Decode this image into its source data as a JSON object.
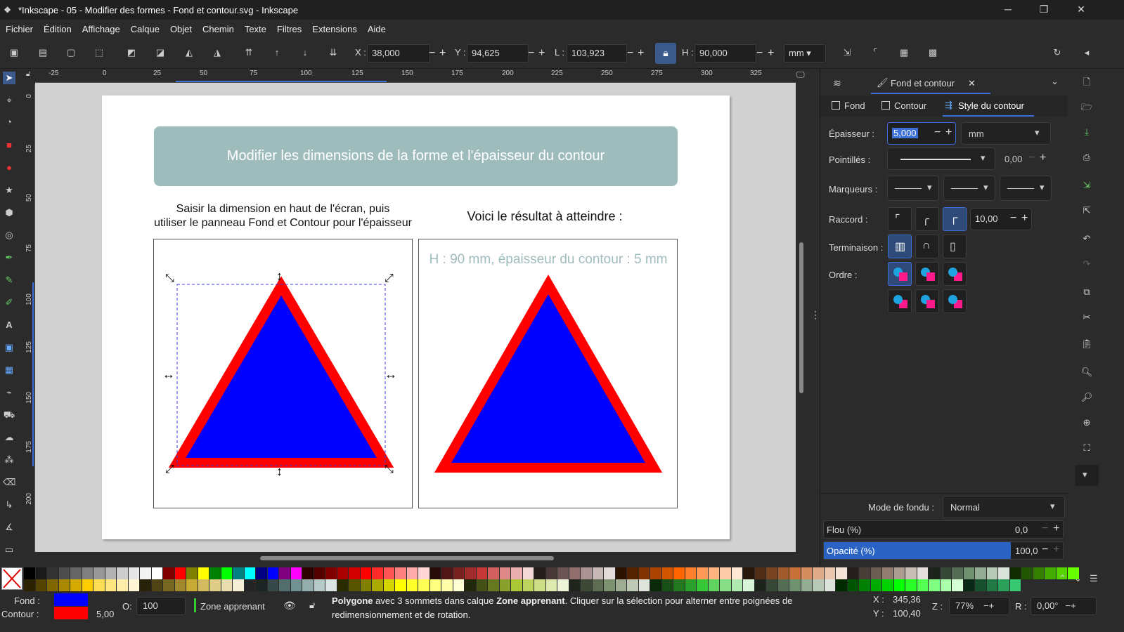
{
  "window": {
    "title": "*Inkscape - 05 - Modifier des formes - Fond et contour.svg - Inkscape",
    "minimize": "─",
    "maximize": "❐",
    "close": "✕"
  },
  "menu": [
    "Fichier",
    "Édition",
    "Affichage",
    "Calque",
    "Objet",
    "Chemin",
    "Texte",
    "Filtres",
    "Extensions",
    "Aide"
  ],
  "toolbar": {
    "x_label": "X :",
    "x_value": "38,000",
    "y_label": "Y :",
    "y_value": "94,625",
    "w_label": "L :",
    "w_value": "103,923",
    "h_label": "H :",
    "h_value": "90,000",
    "unit": "mm",
    "minus": "−",
    "plus": "+"
  },
  "ruler": {
    "h_ticks": [
      "-25",
      "0",
      "25",
      "50",
      "75",
      "100",
      "125",
      "150",
      "175",
      "200",
      "225",
      "250",
      "275",
      "300",
      "325"
    ],
    "v_ticks": [
      "0",
      "25",
      "50",
      "75",
      "100",
      "125",
      "150",
      "175",
      "200"
    ]
  },
  "page": {
    "banner": "Modifier les dimensions de la forme et l'épaisseur du contour",
    "instruction_line1": "Saisir la dimension en haut de l'écran, puis",
    "instruction_line2": "utiliser le panneau Fond et Contour pour l'épaisseur",
    "result_title": "Voici le résultat à atteindre :",
    "hint": "H : 90 mm, épaisseur du contour : 5 mm",
    "fill_color": "#0000ff",
    "stroke_color": "#ff0000"
  },
  "panel": {
    "tab_title": "Fond et contour",
    "tab_close": "✕",
    "subtabs": [
      "Fond",
      "Contour",
      "Style du contour"
    ],
    "epaisseur_label": "Épaisseur :",
    "epaisseur_value": "5,000",
    "epaisseur_unit": "mm",
    "pointilles_label": "Pointillés :",
    "pointilles_offset": "0,00",
    "marqueurs_label": "Marqueurs :",
    "raccord_label": "Raccord :",
    "raccord_value": "10,00",
    "terminaison_label": "Terminaison :",
    "ordre_label": "Ordre :",
    "mode_label": "Mode de fondu :",
    "mode_value": "Normal",
    "flou_label": "Flou (%)",
    "flou_value": "0,0",
    "opacite_label": "Opacité (%)",
    "opacite_value": "100,0",
    "opacite_level": 1.0
  },
  "palette_colors": [
    "#000000",
    "#1a1a1a",
    "#333333",
    "#4d4d4d",
    "#666666",
    "#808080",
    "#999999",
    "#b3b3b3",
    "#cccccc",
    "#e6e6e6",
    "#f2f2f2",
    "#ffffff",
    "#800000",
    "#ff0000",
    "#808000",
    "#ffff00",
    "#008000",
    "#00ff00",
    "#008080",
    "#00ffff",
    "#000080",
    "#0000ff",
    "#800080",
    "#ff00ff",
    "#2b0000",
    "#550000",
    "#800000",
    "#aa0000",
    "#d40000",
    "#ff0000",
    "#ff2a2a",
    "#ff5555",
    "#ff8080",
    "#ffaaaa",
    "#ffd5d5",
    "#280b0b",
    "#501616",
    "#782121",
    "#a02c2c",
    "#c83737",
    "#d35f5f",
    "#de8787",
    "#e9afaf",
    "#f4d7d7",
    "#241c1c",
    "#483737",
    "#6c5353",
    "#916f6f",
    "#ac9393",
    "#c8b7b7",
    "#e3dbdb",
    "#2b1100",
    "#552200",
    "#803300",
    "#aa4400",
    "#d45500",
    "#ff6600",
    "#ff7f2a",
    "#ff9955",
    "#ffb380",
    "#ffccaa",
    "#ffe6d5",
    "#28170b",
    "#502d16",
    "#784421",
    "#a05a2c",
    "#c87137",
    "#d38d5f",
    "#deaa87",
    "#e9c6af",
    "#f4e3d7",
    "#241f1c",
    "#483e37",
    "#6c5d53",
    "#917c6f",
    "#ac9d93",
    "#c8beb7",
    "#e3dedb",
    "#1c241c",
    "#374837",
    "#536c53",
    "#6f916f",
    "#93ac93",
    "#b7c8b7",
    "#dbe3db",
    "#112b00",
    "#225500",
    "#338000",
    "#44aa00",
    "#55d400",
    "#66ff00"
  ],
  "palette_colors2": [
    "#2b2200",
    "#554400",
    "#806600",
    "#aa8800",
    "#d4aa00",
    "#ffcc00",
    "#ffdd55",
    "#ffe680",
    "#ffeeaa",
    "#fff6d5",
    "#28220b",
    "#504416",
    "#786721",
    "#a0892c",
    "#c8ab37",
    "#d3bc5f",
    "#decd87",
    "#e9ddaf",
    "#f4eed7",
    "#242424",
    "#1c2424",
    "#374848",
    "#536c6c",
    "#6f9191",
    "#93acac",
    "#b7c8c8",
    "#dbe3e3",
    "#2b2b00",
    "#555500",
    "#808000",
    "#aaaa00",
    "#d4d400",
    "#ffff00",
    "#ffff2a",
    "#ffff55",
    "#ffff80",
    "#ffffaa",
    "#ffffd5",
    "#22280b",
    "#445016",
    "#677821",
    "#89a02c",
    "#abc837",
    "#bcd35f",
    "#cdde87",
    "#dde9af",
    "#eef4d7",
    "#1f241c",
    "#3e4837",
    "#5d6c53",
    "#7c916f",
    "#9dac93",
    "#bec8b7",
    "#dee3db",
    "#0b280b",
    "#165016",
    "#217821",
    "#2ca02c",
    "#37c837",
    "#5fd35f",
    "#87de87",
    "#afe9af",
    "#d7f4d7",
    "#1c241c",
    "#374837",
    "#536c53",
    "#6f916f",
    "#93ac93",
    "#b7c8b7",
    "#dbe3db",
    "#002b00",
    "#005500",
    "#008000",
    "#00aa00",
    "#00d400",
    "#00ff00",
    "#2aff2a",
    "#55ff55",
    "#80ff80",
    "#aaffaa",
    "#d5ffd5",
    "#0b2816",
    "#16502d",
    "#217844",
    "#2ca05a",
    "#37c871"
  ],
  "status": {
    "fill_label": "Fond :",
    "stroke_label": "Contour :",
    "stroke_width": "5,00",
    "opacity_label": "O:",
    "opacity_value": "100",
    "layer": "Zone apprenant",
    "msg_bold1": "Polygone",
    "msg_text1": " avec 3 sommets dans calque ",
    "msg_bold2": "Zone apprenant",
    "msg_text2": ". Cliquer sur la sélection pour alterner entre poignées de",
    "msg_line2": "redimensionnement et de rotation.",
    "x_label": "X :",
    "x_value": "345,36",
    "y_label": "Y :",
    "y_value": "100,40",
    "z_label": "Z :",
    "zoom": "77%",
    "r_label": "R :",
    "rotation": "0,00°"
  }
}
